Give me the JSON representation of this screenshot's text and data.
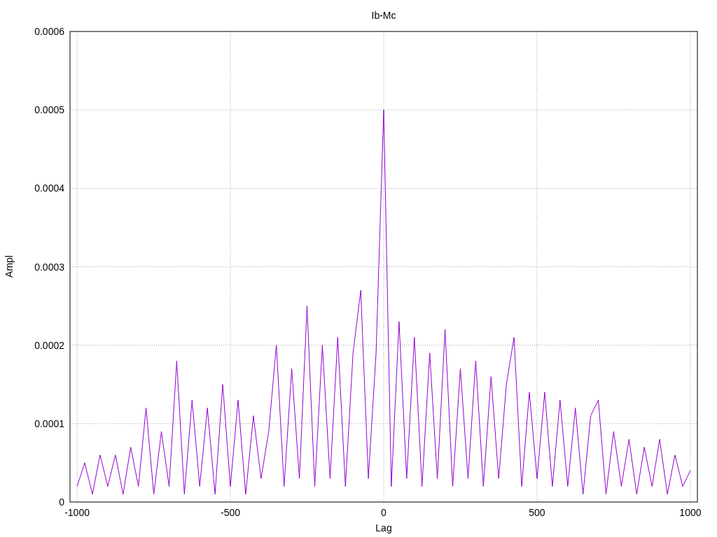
{
  "chart_data": {
    "type": "line",
    "grid": true,
    "title": "Ib-Mc",
    "xlabel": "Lag",
    "ylabel": "Ampl",
    "xlim": [
      -1023,
      1023
    ],
    "ylim": [
      0,
      0.0006
    ],
    "xticks": [
      -1000,
      -500,
      0,
      500,
      1000
    ],
    "yticks": [
      {
        "value": 0,
        "label": "0"
      },
      {
        "value": 0.0001,
        "label": "0.0001"
      },
      {
        "value": 0.0002,
        "label": "0.0002"
      },
      {
        "value": 0.0003,
        "label": "0.0003"
      },
      {
        "value": 0.0004,
        "label": "0.0004"
      },
      {
        "value": 0.0005,
        "label": "0.0005"
      },
      {
        "value": 0.0006,
        "label": "0.0006"
      }
    ],
    "x": [
      -1000,
      -975,
      -950,
      -925,
      -900,
      -875,
      -850,
      -825,
      -800,
      -775,
      -750,
      -725,
      -700,
      -675,
      -650,
      -625,
      -600,
      -575,
      -550,
      -525,
      -500,
      -475,
      -450,
      -425,
      -400,
      -375,
      -350,
      -325,
      -300,
      -275,
      -250,
      -225,
      -200,
      -175,
      -150,
      -125,
      -100,
      -75,
      -50,
      -25,
      0,
      25,
      50,
      75,
      100,
      125,
      150,
      175,
      200,
      225,
      250,
      275,
      300,
      325,
      350,
      375,
      400,
      425,
      450,
      475,
      500,
      525,
      550,
      575,
      600,
      625,
      650,
      675,
      700,
      725,
      750,
      775,
      800,
      825,
      850,
      875,
      900,
      925,
      950,
      975,
      1000
    ],
    "series": [
      {
        "color": "#9400d3",
        "values": [
          2e-05,
          5e-05,
          1e-05,
          6e-05,
          2e-05,
          6e-05,
          1e-05,
          7e-05,
          2e-05,
          0.00012,
          1e-05,
          9e-05,
          2e-05,
          0.00018,
          1e-05,
          0.00013,
          2e-05,
          0.00012,
          1e-05,
          0.00015,
          2e-05,
          0.00013,
          1e-05,
          0.00011,
          3e-05,
          9e-05,
          0.0002,
          2e-05,
          0.00017,
          3e-05,
          0.00025,
          2e-05,
          0.0002,
          3e-05,
          0.00021,
          2e-05,
          0.00019,
          0.00027,
          3e-05,
          0.00019,
          0.0005,
          2e-05,
          0.00023,
          3e-05,
          0.00021,
          2e-05,
          0.00019,
          3e-05,
          0.00022,
          2e-05,
          0.00017,
          3e-05,
          0.00018,
          2e-05,
          0.00016,
          3e-05,
          0.00015,
          0.00021,
          2e-05,
          0.00014,
          3e-05,
          0.00014,
          2e-05,
          0.00013,
          2e-05,
          0.00012,
          1e-05,
          0.00011,
          0.00013,
          1e-05,
          9e-05,
          2e-05,
          8e-05,
          1e-05,
          7e-05,
          2e-05,
          8e-05,
          1e-05,
          6e-05,
          2e-05,
          4e-05
        ]
      }
    ]
  }
}
